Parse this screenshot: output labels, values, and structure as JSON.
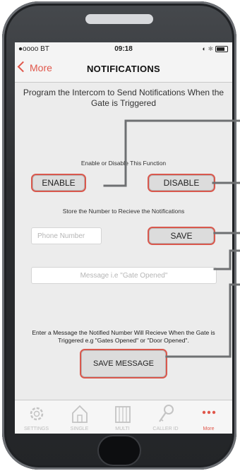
{
  "status_bar": {
    "carrier": "●oooo BT",
    "time": "09:18"
  },
  "nav": {
    "back_label": "More",
    "title": "NOTIFICATIONS"
  },
  "heading": "Program the Intercom to Send Notifications When the Gate is Triggered",
  "enable_section": {
    "label": "Enable or Disable This Function",
    "enable_button": "ENABLE",
    "disable_button": "DISABLE"
  },
  "number_section": {
    "label": "Store the Number to Recieve the Notifications",
    "phone_placeholder": "Phone Number",
    "save_button": "SAVE"
  },
  "message_section": {
    "placeholder": "Message i.e \"Gate Opened\"",
    "description": "Enter a Message the Notified Number Will Recieve When the Gate is Triggered e.g \"Gates Opened\" or \"Door Opened\".",
    "save_button": "SAVE MESSAGE"
  },
  "tabs": [
    {
      "label": "SETTINGS",
      "icon": "gear-icon"
    },
    {
      "label": "SINGLE",
      "icon": "house-icon"
    },
    {
      "label": "MULTI",
      "icon": "apartment-icon"
    },
    {
      "label": "CALLER ID",
      "icon": "key-icon"
    },
    {
      "label": "More",
      "icon": "more-dots-icon"
    }
  ],
  "colors": {
    "accent": "#e0574b",
    "background": "#ececec",
    "bezel": "#2b2d30",
    "callout": "#6e7072"
  }
}
